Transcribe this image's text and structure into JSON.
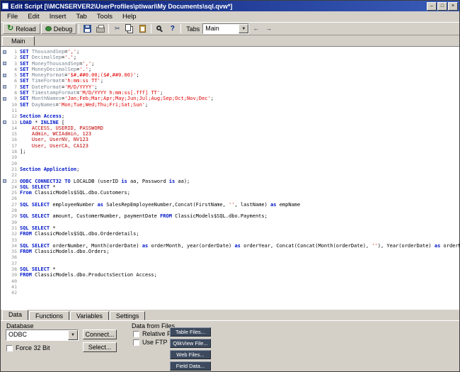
{
  "window": {
    "title": "Edit Script [\\\\MCNSERVER2\\UserProfiles\\ptiwari\\My Documents\\sql.qvw*]",
    "controls": {
      "minimize": "–",
      "maximize": "□",
      "close": "×"
    }
  },
  "colors": {
    "titlebar": "#0a1c72",
    "keyword": "#0016c8",
    "string": "#e00000",
    "inline_data": "#c00000",
    "panel": "#d4d0c8",
    "dark_button": "#3d4a5e"
  },
  "icons": {
    "dropdown": "▼"
  },
  "menu": {
    "items": [
      "File",
      "Edit",
      "Insert",
      "Tab",
      "Tools",
      "Help"
    ]
  },
  "toolbar": {
    "reload_label": "Reload",
    "debug_label": "Debug",
    "reload_icon": "↻",
    "cut_icon": "✂",
    "help_icon": "?",
    "left_icon": "←",
    "right_icon": "→",
    "tabs_label": "Tabs",
    "tab_select_value": "Main"
  },
  "script_tabs": {
    "items": [
      "Main"
    ]
  },
  "editor": {
    "lines": [
      {
        "n": 1,
        "g": true,
        "s": [
          [
            "k",
            "SET "
          ],
          [
            "v",
            "ThousandSep"
          ],
          [
            "p",
            "="
          ],
          [
            "s",
            "','"
          ],
          [
            "p",
            ";"
          ]
        ]
      },
      {
        "n": 2,
        "s": [
          [
            "k",
            "SET "
          ],
          [
            "v",
            "DecimalSep"
          ],
          [
            "p",
            "="
          ],
          [
            "s",
            "'.'"
          ],
          [
            "p",
            ";"
          ]
        ]
      },
      {
        "n": 3,
        "g": true,
        "s": [
          [
            "k",
            "SET "
          ],
          [
            "v",
            "MoneyThousandSep"
          ],
          [
            "p",
            "="
          ],
          [
            "s",
            "','"
          ],
          [
            "p",
            ";"
          ]
        ]
      },
      {
        "n": 4,
        "s": [
          [
            "k",
            "SET "
          ],
          [
            "v",
            "MoneyDecimalSep"
          ],
          [
            "p",
            "="
          ],
          [
            "s",
            "'.'"
          ],
          [
            "p",
            ";"
          ]
        ]
      },
      {
        "n": 5,
        "g": true,
        "s": [
          [
            "k",
            "SET "
          ],
          [
            "v",
            "MoneyFormat"
          ],
          [
            "p",
            "="
          ],
          [
            "s",
            "'$#,##0.00;($#,##0.00)'"
          ],
          [
            "p",
            ";"
          ]
        ]
      },
      {
        "n": 6,
        "s": [
          [
            "k",
            "SET "
          ],
          [
            "v",
            "TimeFormat"
          ],
          [
            "p",
            "="
          ],
          [
            "s",
            "'h:mm:ss TT'"
          ],
          [
            "p",
            ";"
          ]
        ]
      },
      {
        "n": 7,
        "g": true,
        "s": [
          [
            "k",
            "SET "
          ],
          [
            "v",
            "DateFormat"
          ],
          [
            "p",
            "="
          ],
          [
            "s",
            "'M/D/YYYY'"
          ],
          [
            "p",
            ";"
          ]
        ]
      },
      {
        "n": 8,
        "s": [
          [
            "k",
            "SET "
          ],
          [
            "v",
            "TimestampFormat"
          ],
          [
            "p",
            "="
          ],
          [
            "s",
            "'M/D/YYYY h:mm:ss[.fff] TT'"
          ],
          [
            "p",
            ";"
          ]
        ]
      },
      {
        "n": 9,
        "g": true,
        "s": [
          [
            "k",
            "SET "
          ],
          [
            "v",
            "MonthNames"
          ],
          [
            "p",
            "="
          ],
          [
            "s",
            "'Jan;Feb;Mar;Apr;May;Jun;Jul;Aug;Sep;Oct;Nov;Dec'"
          ],
          [
            "p",
            ";"
          ]
        ]
      },
      {
        "n": 10,
        "s": [
          [
            "k",
            "SET "
          ],
          [
            "v",
            "DayNames"
          ],
          [
            "p",
            "="
          ],
          [
            "s",
            "'Mon;Tue;Wed;Thu;Fri;Sat;Sun'"
          ],
          [
            "p",
            ";"
          ]
        ]
      },
      {
        "n": 11,
        "s": []
      },
      {
        "n": 12,
        "s": [
          [
            "k",
            "Section Access"
          ],
          [
            "p",
            ";"
          ]
        ]
      },
      {
        "n": 13,
        "g": true,
        "s": [
          [
            "k",
            "LOAD"
          ],
          [
            "p",
            " * "
          ],
          [
            "k",
            "INLINE"
          ],
          [
            "p",
            " ["
          ]
        ]
      },
      {
        "n": 14,
        "s": [
          [
            "d",
            "    ACCESS, USERID, PASSWORD"
          ]
        ]
      },
      {
        "n": 15,
        "s": [
          [
            "d",
            "    Admin, WCIAdmin, 123"
          ]
        ]
      },
      {
        "n": 16,
        "s": [
          [
            "d",
            "    User, UserNV, NV123"
          ]
        ]
      },
      {
        "n": 17,
        "s": [
          [
            "d",
            "    User, UserCA, CA123"
          ]
        ]
      },
      {
        "n": 18,
        "s": [
          [
            "p",
            "];"
          ]
        ]
      },
      {
        "n": 19,
        "s": []
      },
      {
        "n": 20,
        "s": []
      },
      {
        "n": 21,
        "s": [
          [
            "k",
            "Section Application"
          ],
          [
            "p",
            ";"
          ]
        ]
      },
      {
        "n": 22,
        "s": []
      },
      {
        "n": 23,
        "g": true,
        "s": [
          [
            "k",
            "ODBC CONNECT32 TO"
          ],
          [
            "p",
            " LOCALDB (userID "
          ],
          [
            "k",
            "is"
          ],
          [
            "p",
            " aa, Password "
          ],
          [
            "k",
            "is"
          ],
          [
            "p",
            " aa);"
          ]
        ]
      },
      {
        "n": 24,
        "s": [
          [
            "k",
            "SQL SELECT"
          ],
          [
            "p",
            " *"
          ]
        ]
      },
      {
        "n": 25,
        "s": [
          [
            "k",
            "From"
          ],
          [
            "p",
            " ClassicModels$SQL.dbo.Customers;"
          ]
        ]
      },
      {
        "n": 26,
        "s": []
      },
      {
        "n": 27,
        "s": [
          [
            "k",
            "SQL SELECT"
          ],
          [
            "p",
            " employeeNumber "
          ],
          [
            "k",
            "as"
          ],
          [
            "p",
            " SalesRepEmployeeNumber,Concat(FirstName, "
          ],
          [
            "s",
            "''"
          ],
          [
            "p",
            ", lastName) "
          ],
          [
            "k",
            "as"
          ],
          [
            "p",
            " empName"
          ]
        ]
      },
      {
        "n": 28,
        "s": []
      },
      {
        "n": 29,
        "s": [
          [
            "k",
            "SQL SELECT"
          ],
          [
            "p",
            " amount, CustomerNumber, paymentDate "
          ],
          [
            "k",
            "FROM"
          ],
          [
            "p",
            " ClassicModels$SQL.dbo.Payments;"
          ]
        ]
      },
      {
        "n": 30,
        "s": []
      },
      {
        "n": 31,
        "s": [
          [
            "k",
            "SQL SELECT"
          ],
          [
            "p",
            " *"
          ]
        ]
      },
      {
        "n": 32,
        "s": [
          [
            "k",
            "FROM"
          ],
          [
            "p",
            " ClassicModels$SQL.dbo.Orderdetails;"
          ]
        ]
      },
      {
        "n": 33,
        "s": []
      },
      {
        "n": 34,
        "s": [
          [
            "k",
            "SQL SELECT"
          ],
          [
            "p",
            " orderNumber, Month(orderDate) "
          ],
          [
            "k",
            "as"
          ],
          [
            "p",
            " orderMonth, year(orderDate) "
          ],
          [
            "k",
            "as"
          ],
          [
            "p",
            " orderYear, Concat(Concat(Month(orderDate), "
          ],
          [
            "s",
            "''"
          ],
          [
            "p",
            "), Year(orderDate) "
          ],
          [
            "k",
            "as"
          ],
          [
            "p",
            " orderMy, customerNumber"
          ]
        ]
      },
      {
        "n": 35,
        "s": [
          [
            "k",
            "FROM"
          ],
          [
            "p",
            " ClassicModels.dbo.Orders;"
          ]
        ]
      },
      {
        "n": 36,
        "s": []
      },
      {
        "n": 37,
        "s": []
      },
      {
        "n": 38,
        "s": [
          [
            "k",
            "SQL SELECT"
          ],
          [
            "p",
            " *"
          ]
        ]
      },
      {
        "n": 39,
        "s": [
          [
            "k",
            "FROM"
          ],
          [
            "p",
            " ClassicModels.dbo.ProductsSection Access;"
          ]
        ]
      },
      {
        "n": 40,
        "s": []
      },
      {
        "n": 41,
        "s": []
      },
      {
        "n": 42,
        "s": []
      }
    ]
  },
  "bottom": {
    "tabs": [
      "Data",
      "Functions",
      "Variables",
      "Settings"
    ],
    "active_tab": "Data",
    "database": {
      "label": "Database",
      "select_value": "ODBC",
      "connect_label": "Connect...",
      "select_button_label": "Select...",
      "force32_label": "Force 32 Bit"
    },
    "files": {
      "label": "Data from Files",
      "relative_paths_label": "Relative Paths",
      "use_ftp_label": "Use FTP",
      "buttons": [
        "Table Files...",
        "QlikView File...",
        "Web Files...",
        "Field Data..."
      ]
    }
  }
}
